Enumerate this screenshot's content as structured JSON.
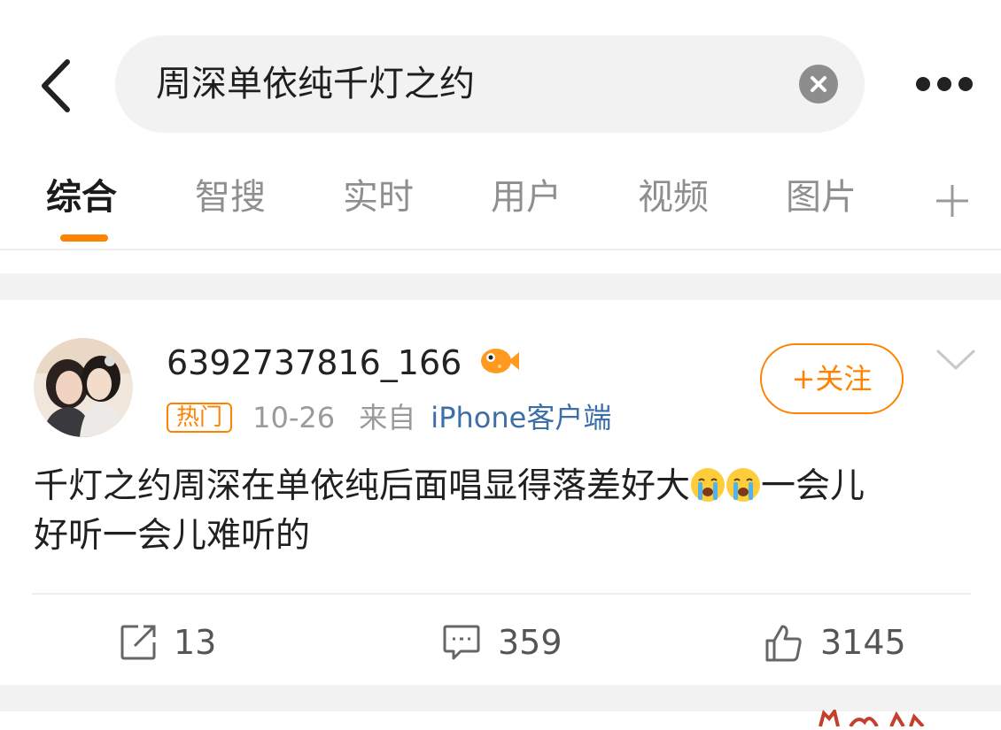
{
  "search": {
    "query": "周深单依纯千灯之约"
  },
  "tabs": [
    {
      "label": "综合",
      "active": true
    },
    {
      "label": "智搜",
      "active": false
    },
    {
      "label": "实时",
      "active": false
    },
    {
      "label": "用户",
      "active": false
    },
    {
      "label": "视频",
      "active": false
    },
    {
      "label": "图片",
      "active": false
    }
  ],
  "colors": {
    "accent": "#ff8200",
    "source_link": "#3c6ea8",
    "background_gap": "#f2f2f2"
  },
  "post": {
    "username": "6392737816_166",
    "badge": "热门",
    "date": "10-26",
    "source_prefix": "来自",
    "source": "iPhone客户端",
    "follow_label": "+关注",
    "content_line1_a": "千灯之约周深在单依纯后面唱显得落差好大",
    "content_line1_b": "一会儿",
    "content_line2": "好听一会儿难听的",
    "emoji": "crying-face-icon",
    "actions": {
      "reposts": "13",
      "comments": "359",
      "likes": "3145"
    }
  },
  "icons": {
    "back": "chevron-left-icon",
    "clear": "clear-x-icon",
    "more": "more-horizontal-icon",
    "plus": "plus-icon",
    "verified": "fish-badge-icon",
    "dropdown": "chevron-down-icon",
    "repost": "share-icon",
    "comment": "comment-icon",
    "like": "thumbs-up-icon"
  }
}
